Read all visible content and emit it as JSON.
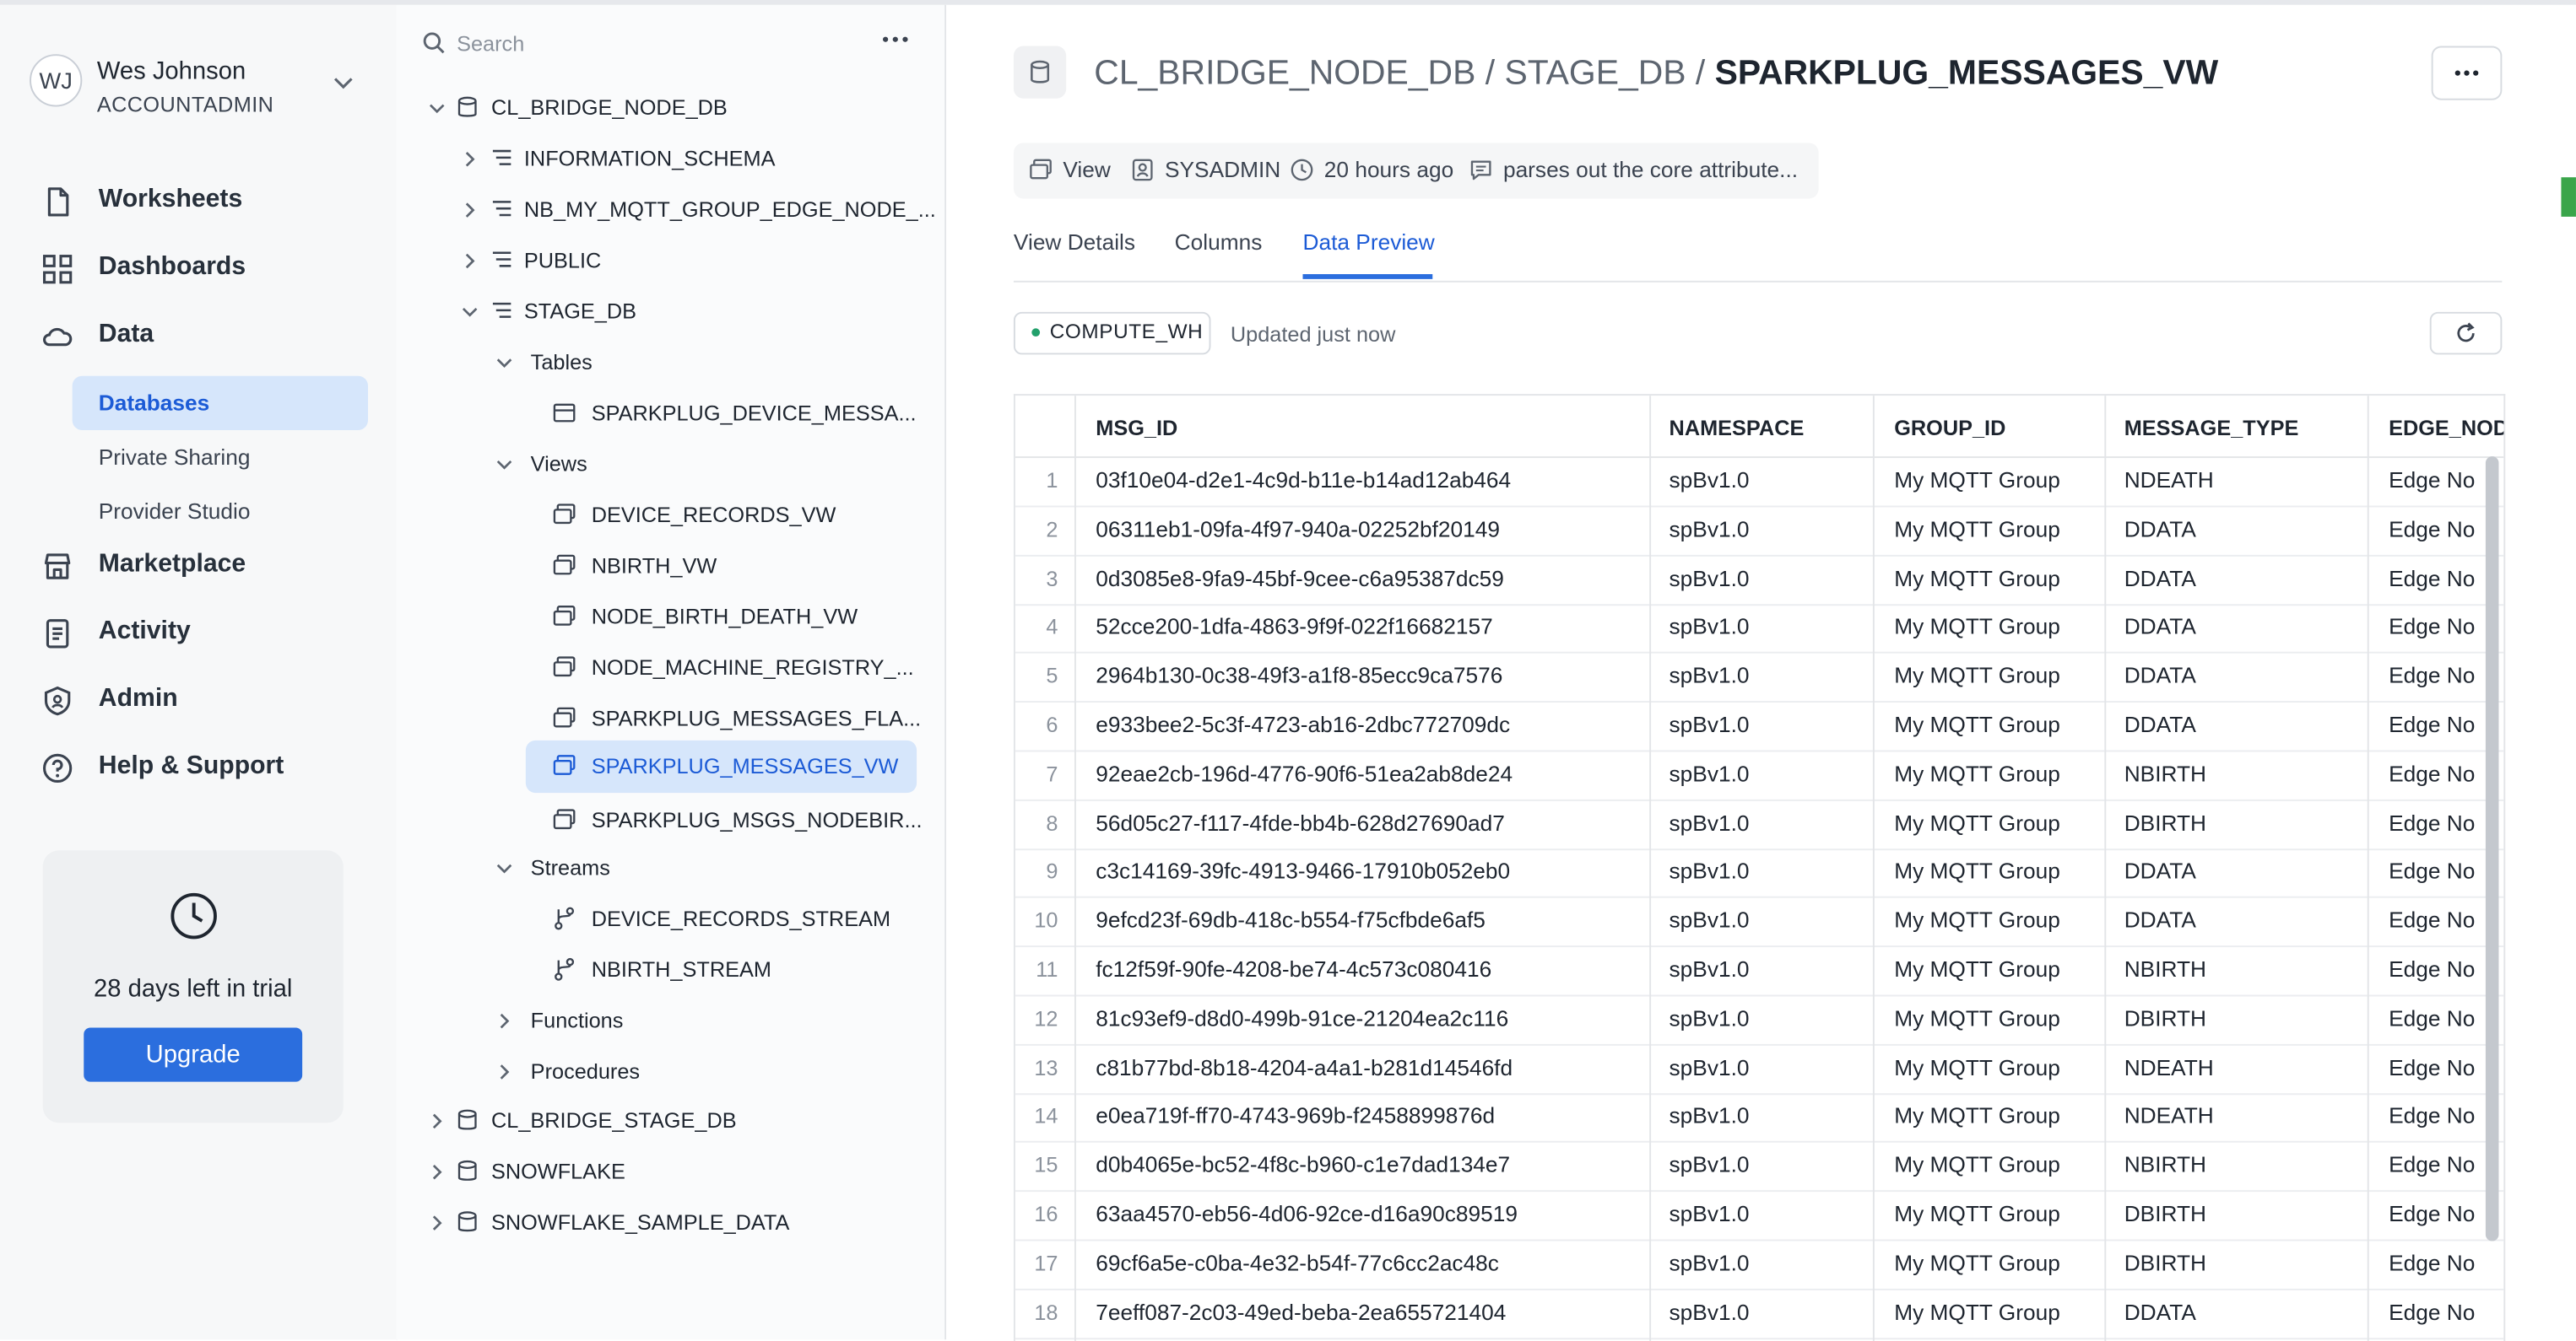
{
  "user": {
    "initials": "WJ",
    "name": "Wes Johnson",
    "role": "ACCOUNTADMIN"
  },
  "nav": {
    "worksheets": "Worksheets",
    "dashboards": "Dashboards",
    "data": "Data",
    "databases": "Databases",
    "private_sharing": "Private Sharing",
    "provider_studio": "Provider Studio",
    "marketplace": "Marketplace",
    "activity": "Activity",
    "admin": "Admin",
    "help": "Help & Support"
  },
  "trial": {
    "text": "28 days left in trial",
    "button": "Upgrade"
  },
  "tree": {
    "search_placeholder": "Search",
    "db1": "CL_BRIDGE_NODE_DB",
    "info_schema": "INFORMATION_SCHEMA",
    "nb_schema": "NB_MY_MQTT_GROUP_EDGE_NODE_...",
    "public": "PUBLIC",
    "stage_db": "STAGE_DB",
    "tables": "Tables",
    "table1": "SPARKPLUG_DEVICE_MESSA...",
    "views": "Views",
    "view1": "DEVICE_RECORDS_VW",
    "view2": "NBIRTH_VW",
    "view3": "NODE_BIRTH_DEATH_VW",
    "view4": "NODE_MACHINE_REGISTRY_...",
    "view5": "SPARKPLUG_MESSAGES_FLA...",
    "view6": "SPARKPLUG_MESSAGES_VW",
    "view7": "SPARKPLUG_MSGS_NODEBIR...",
    "streams": "Streams",
    "stream1": "DEVICE_RECORDS_STREAM",
    "stream2": "NBIRTH_STREAM",
    "functions": "Functions",
    "procedures": "Procedures",
    "db2": "CL_BRIDGE_STAGE_DB",
    "db3": "SNOWFLAKE",
    "db4": "SNOWFLAKE_SAMPLE_DATA"
  },
  "header": {
    "db": "CL_BRIDGE_NODE_DB",
    "sep1": " / ",
    "schema": "STAGE_DB",
    "sep2": " / ",
    "object": "SPARKPLUG_MESSAGES_VW"
  },
  "meta": {
    "type": "View",
    "owner": "SYSADMIN",
    "time": "20 hours ago",
    "comment": "parses out the core attribute..."
  },
  "tabs": {
    "details": "View Details",
    "columns": "Columns",
    "preview": "Data Preview"
  },
  "toolbar": {
    "warehouse": "COMPUTE_WH",
    "updated": "Updated just now"
  },
  "table": {
    "columns": [
      "MSG_ID",
      "NAMESPACE",
      "GROUP_ID",
      "MESSAGE_TYPE",
      "EDGE_NOD"
    ],
    "rows": [
      [
        "1",
        "03f10e04-d2e1-4c9d-b11e-b14ad12ab464",
        "spBv1.0",
        "My MQTT Group",
        "NDEATH",
        "Edge No"
      ],
      [
        "2",
        "06311eb1-09fa-4f97-940a-02252bf20149",
        "spBv1.0",
        "My MQTT Group",
        "DDATA",
        "Edge No"
      ],
      [
        "3",
        "0d3085e8-9fa9-45bf-9cee-c6a95387dc59",
        "spBv1.0",
        "My MQTT Group",
        "DDATA",
        "Edge No"
      ],
      [
        "4",
        "52cce200-1dfa-4863-9f9f-022f16682157",
        "spBv1.0",
        "My MQTT Group",
        "DDATA",
        "Edge No"
      ],
      [
        "5",
        "2964b130-0c38-49f3-a1f8-85ecc9ca7576",
        "spBv1.0",
        "My MQTT Group",
        "DDATA",
        "Edge No"
      ],
      [
        "6",
        "e933bee2-5c3f-4723-ab16-2dbc772709dc",
        "spBv1.0",
        "My MQTT Group",
        "DDATA",
        "Edge No"
      ],
      [
        "7",
        "92eae2cb-196d-4776-90f6-51ea2ab8de24",
        "spBv1.0",
        "My MQTT Group",
        "NBIRTH",
        "Edge No"
      ],
      [
        "8",
        "56d05c27-f117-4fde-bb4b-628d27690ad7",
        "spBv1.0",
        "My MQTT Group",
        "DBIRTH",
        "Edge No"
      ],
      [
        "9",
        "c3c14169-39fc-4913-9466-17910b052eb0",
        "spBv1.0",
        "My MQTT Group",
        "DDATA",
        "Edge No"
      ],
      [
        "10",
        "9efcd23f-69db-418c-b554-f75cfbde6af5",
        "spBv1.0",
        "My MQTT Group",
        "DDATA",
        "Edge No"
      ],
      [
        "11",
        "fc12f59f-90fe-4208-be74-4c573c080416",
        "spBv1.0",
        "My MQTT Group",
        "NBIRTH",
        "Edge No"
      ],
      [
        "12",
        "81c93ef9-d8d0-499b-91ce-21204ea2c116",
        "spBv1.0",
        "My MQTT Group",
        "DBIRTH",
        "Edge No"
      ],
      [
        "13",
        "c81b77bd-8b18-4204-a4a1-b281d14546fd",
        "spBv1.0",
        "My MQTT Group",
        "NDEATH",
        "Edge No"
      ],
      [
        "14",
        "e0ea719f-ff70-4743-969b-f2458899876d",
        "spBv1.0",
        "My MQTT Group",
        "NDEATH",
        "Edge No"
      ],
      [
        "15",
        "d0b4065e-bc52-4f8c-b960-c1e7dad134e7",
        "spBv1.0",
        "My MQTT Group",
        "NBIRTH",
        "Edge No"
      ],
      [
        "16",
        "63aa4570-eb56-4d06-92ce-d16a90c89519",
        "spBv1.0",
        "My MQTT Group",
        "DBIRTH",
        "Edge No"
      ],
      [
        "17",
        "69cf6a5e-c0ba-4e32-b54f-77c6cc2ac48c",
        "spBv1.0",
        "My MQTT Group",
        "DBIRTH",
        "Edge No"
      ],
      [
        "18",
        "7eeff087-2c03-49ed-beba-2ea655721404",
        "spBv1.0",
        "My MQTT Group",
        "DDATA",
        "Edge No"
      ]
    ]
  },
  "colors": {
    "accent": "#2b6ede",
    "selection": "#d6e6fb",
    "warehouse_dot": "#22a06b"
  }
}
